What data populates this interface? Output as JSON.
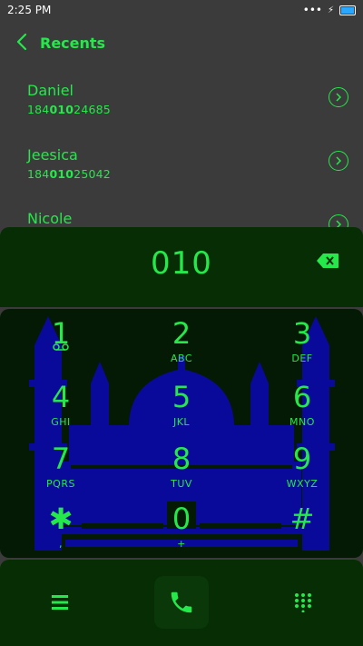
{
  "status": {
    "time": "2:25 PM",
    "dots": "•••",
    "bolt": "⚡"
  },
  "header": {
    "title": "Recents"
  },
  "contacts": [
    {
      "name": "Daniel",
      "num_pre": "184",
      "num_match": "010",
      "num_post": "24685"
    },
    {
      "name": "Jeesica",
      "num_pre": "184",
      "num_match": "010",
      "num_post": "25042"
    },
    {
      "name": "Nicole",
      "num_pre": "",
      "num_match": "",
      "num_post": ""
    }
  ],
  "dialer": {
    "number": "010"
  },
  "keys": [
    {
      "d": "1",
      "l": ""
    },
    {
      "d": "2",
      "l": "ABC"
    },
    {
      "d": "3",
      "l": "DEF"
    },
    {
      "d": "4",
      "l": "GHI"
    },
    {
      "d": "5",
      "l": "JKL"
    },
    {
      "d": "6",
      "l": "MNO"
    },
    {
      "d": "7",
      "l": "PQRS"
    },
    {
      "d": "8",
      "l": "TUV"
    },
    {
      "d": "9",
      "l": "WXYZ"
    },
    {
      "d": "✱",
      "l": ","
    },
    {
      "d": "0",
      "l": "+"
    },
    {
      "d": "#",
      "l": ""
    }
  ],
  "colors": {
    "accent": "#25e84a",
    "panel": "#062d03",
    "mosque": "#0a0a9a"
  },
  "icons": {
    "menu": "menu-icon",
    "call": "phone-icon",
    "grid": "keypad-grid-icon"
  }
}
